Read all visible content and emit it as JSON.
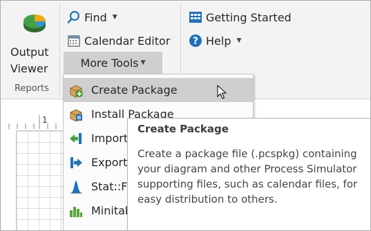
{
  "ribbon": {
    "output_viewer": {
      "line1": "Output",
      "line2": "Viewer"
    },
    "reports_group_label": "Reports",
    "find_label": "Find",
    "calendar_editor_label": "Calendar Editor",
    "more_tools_label": "More Tools",
    "getting_started_label": "Getting Started",
    "help_label": "Help"
  },
  "ruler": {
    "tick_1": "1"
  },
  "menu": {
    "items": [
      {
        "label": "Create Package",
        "icon": "package-create-icon"
      },
      {
        "label": "Install Package",
        "icon": "package-install-icon"
      },
      {
        "label": "Import",
        "icon": "import-arrow-icon"
      },
      {
        "label": "Export",
        "icon": "export-arrow-icon"
      },
      {
        "label": "Stat::Fit",
        "icon": "statfit-chart-icon"
      },
      {
        "label": "Minitab",
        "icon": "minitab-bars-icon"
      }
    ]
  },
  "tooltip": {
    "title": "Create Package",
    "body": "Create a package file (.pcspkg) containing your diagram and other Process Simulator supporting files, such as calendar files, for easy distribution to others."
  },
  "colors": {
    "ribbon_bg": "#f3f3f3",
    "menu_hover": "#cfcfcf",
    "accent_blue": "#1e73be",
    "help_blue": "#1e6fc0"
  }
}
